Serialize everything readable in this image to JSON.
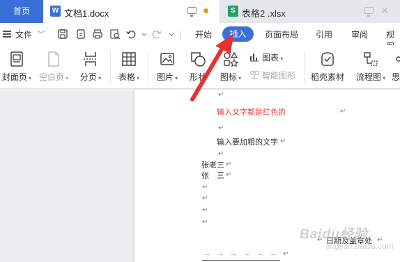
{
  "tabs": {
    "home": "首页",
    "doc": {
      "name": "文档1.docx",
      "icon": "W"
    },
    "sheet": {
      "name": "表格2 .xlsx",
      "icon": "S"
    }
  },
  "menu": {
    "file": "文件",
    "items": [
      "开始",
      "插入",
      "页面布局",
      "引用",
      "审阅",
      "视图"
    ],
    "active": "插入"
  },
  "ribbon": {
    "cover": "封面页",
    "blank": "空白页",
    "pagebreak": "分页",
    "table": "表格",
    "picture": "图片",
    "shape": "形状",
    "icons": "图标",
    "chart": "图表",
    "smartart": "智能图形",
    "material": "稻壳素材",
    "flowchart": "流程图",
    "more": "思"
  },
  "document": {
    "red_line": "输入文字都是红色的",
    "bold_line": "输入要加粗的文字",
    "name1": "张老三",
    "name2": "张　三",
    "signature": "日期及盖章处",
    "para_mark": "↵",
    "tab_mark": "→"
  },
  "watermark": {
    "text": "Baidu经验",
    "sub": "jingyan.baidu.com"
  },
  "colors": {
    "accent": "#3a6fd8",
    "red_text": "#e23b3b",
    "excel": "#21a366",
    "arrow": "#e8312f"
  }
}
